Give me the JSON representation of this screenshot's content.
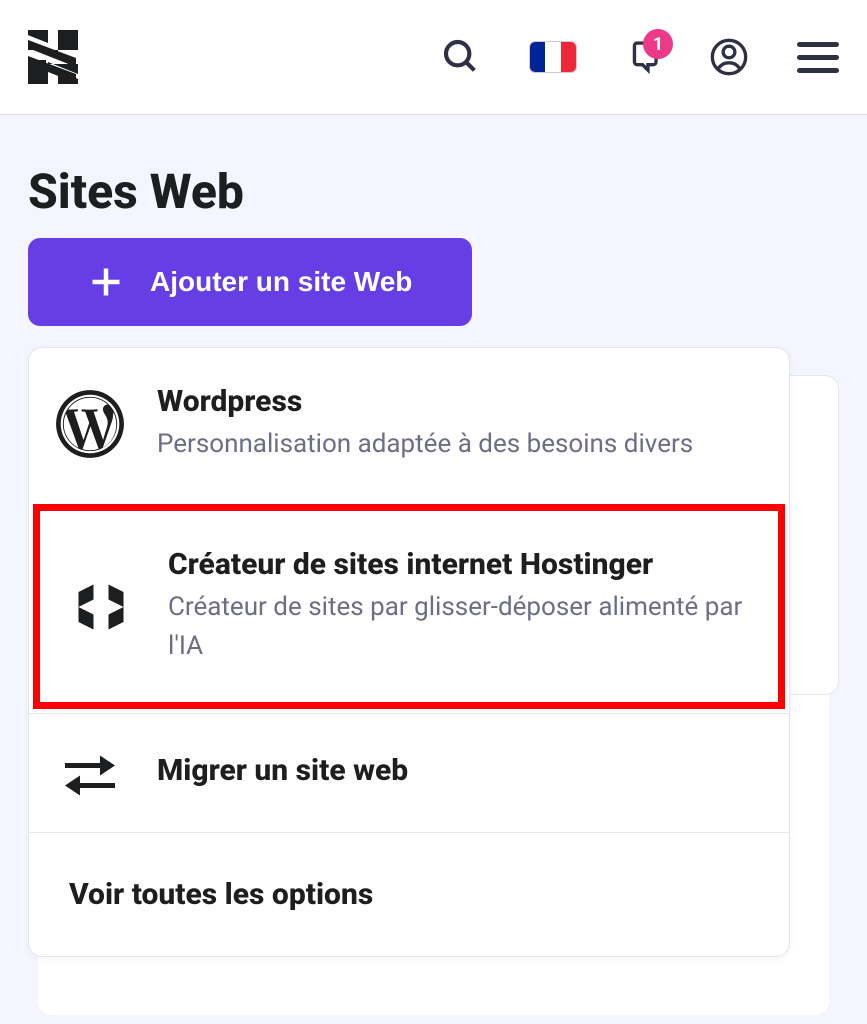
{
  "header": {
    "notification_count": "1"
  },
  "page": {
    "title": "Sites Web"
  },
  "add_button": {
    "label": "Ajouter un site Web"
  },
  "dropdown": {
    "items": [
      {
        "title": "Wordpress",
        "desc": "Personnalisation adaptée à des besoins divers"
      },
      {
        "title": "Créateur de sites internet Hostinger",
        "desc": "Créateur de sites par glisser-déposer alimenté par l'IA"
      },
      {
        "title": "Migrer un site web"
      }
    ],
    "all_options": "Voir toutes les options"
  }
}
